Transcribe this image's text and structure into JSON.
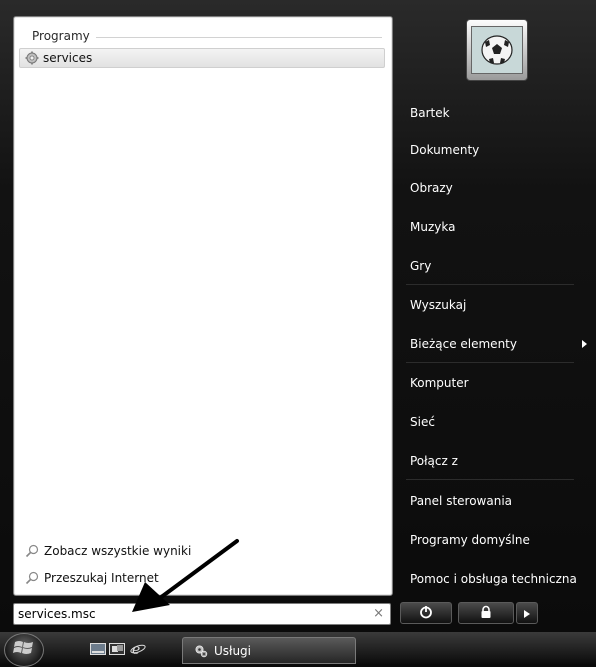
{
  "left_pane": {
    "group_header": "Programy",
    "results": [
      {
        "label": "services",
        "icon": "gear-icon"
      }
    ],
    "links": [
      {
        "label": "Zobacz wszystkie wyniki",
        "icon": "search-icon"
      },
      {
        "label": "Przeszukaj Internet",
        "icon": "search-icon"
      }
    ]
  },
  "search": {
    "value": "services.msc",
    "clear_label": "×"
  },
  "right_pane": {
    "user_picture": "soccer-ball-avatar",
    "items": [
      "Bartek",
      "Dokumenty",
      "Obrazy",
      "Muzyka",
      "Gry",
      "Wyszukaj",
      "Bieżące elementy",
      "Komputer",
      "Sieć",
      "Połącz z",
      "Panel sterowania",
      "Programy domyślne",
      "Pomoc i obsługa techniczna"
    ]
  },
  "power": {
    "power_icon": "power-icon",
    "lock_icon": "lock-icon",
    "more_icon": "arrow-right-icon"
  },
  "taskbar": {
    "quick_launch": [
      "show-desktop-icon",
      "switch-windows-icon",
      "internet-explorer-icon"
    ],
    "task_label": "Usługi",
    "task_icon": "gear-icon"
  },
  "annotation": {
    "arrow": "pointer-arrow"
  }
}
